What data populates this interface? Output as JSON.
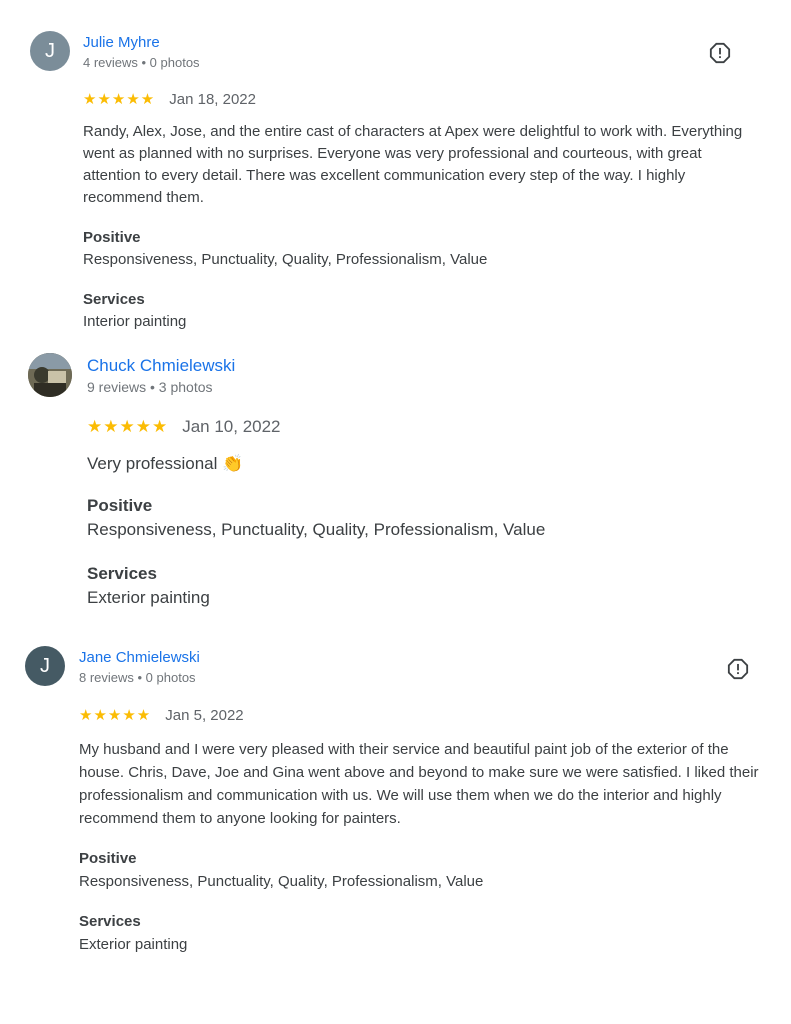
{
  "reviews": [
    {
      "avatar_letter": "J",
      "avatar_color": "#7b8d99",
      "name": "Julie Myhre",
      "meta": "4 reviews • 0 photos",
      "stars": "★★★★★",
      "rating": 5,
      "date": "Jan 18, 2022",
      "text": "Randy, Alex, Jose, and the entire cast of characters at Apex were delightful to work with. Everything went as planned with no surprises. Everyone was very professional and courteous, with great attention to every detail. There was excellent communication every step of the way. I highly recommend them.",
      "positive_label": "Positive",
      "positive_value": "Responsiveness, Punctuality, Quality, Professionalism, Value",
      "services_label": "Services",
      "services_value": "Interior painting",
      "has_flag": true
    },
    {
      "avatar_letter": "",
      "avatar_color": "#4a4a3a",
      "name": "Chuck Chmielewski",
      "meta": "9 reviews • 3 photos",
      "stars": "★★★★★",
      "rating": 5,
      "date": "Jan 10, 2022",
      "text": "Very professional 👏",
      "positive_label": "Positive",
      "positive_value": "Responsiveness, Punctuality, Quality, Professionalism, Value",
      "services_label": "Services",
      "services_value": "Exterior painting",
      "has_flag": false
    },
    {
      "avatar_letter": "J",
      "avatar_color": "#455a64",
      "name": "Jane Chmielewski",
      "meta": "8 reviews • 0 photos",
      "stars": "★★★★★",
      "rating": 5,
      "date": "Jan 5, 2022",
      "text": "My husband and I were very pleased with their service and beautiful paint job of the exterior of the house. Chris, Dave, Joe and Gina went above and beyond to make sure we were satisfied. I liked their professionalism and communication with us. We will use them when we do the interior and highly recommend them to anyone looking for painters.",
      "positive_label": "Positive",
      "positive_value": "Responsiveness, Punctuality, Quality, Professionalism, Value",
      "services_label": "Services",
      "services_value": "Exterior painting",
      "has_flag": true
    }
  ],
  "colors": {
    "link": "#1a73e8",
    "star": "#fbbc04",
    "muted": "#70757a",
    "text": "#3c4043"
  },
  "icons": {
    "flag": "report-flag-icon",
    "star": "star-icon"
  }
}
